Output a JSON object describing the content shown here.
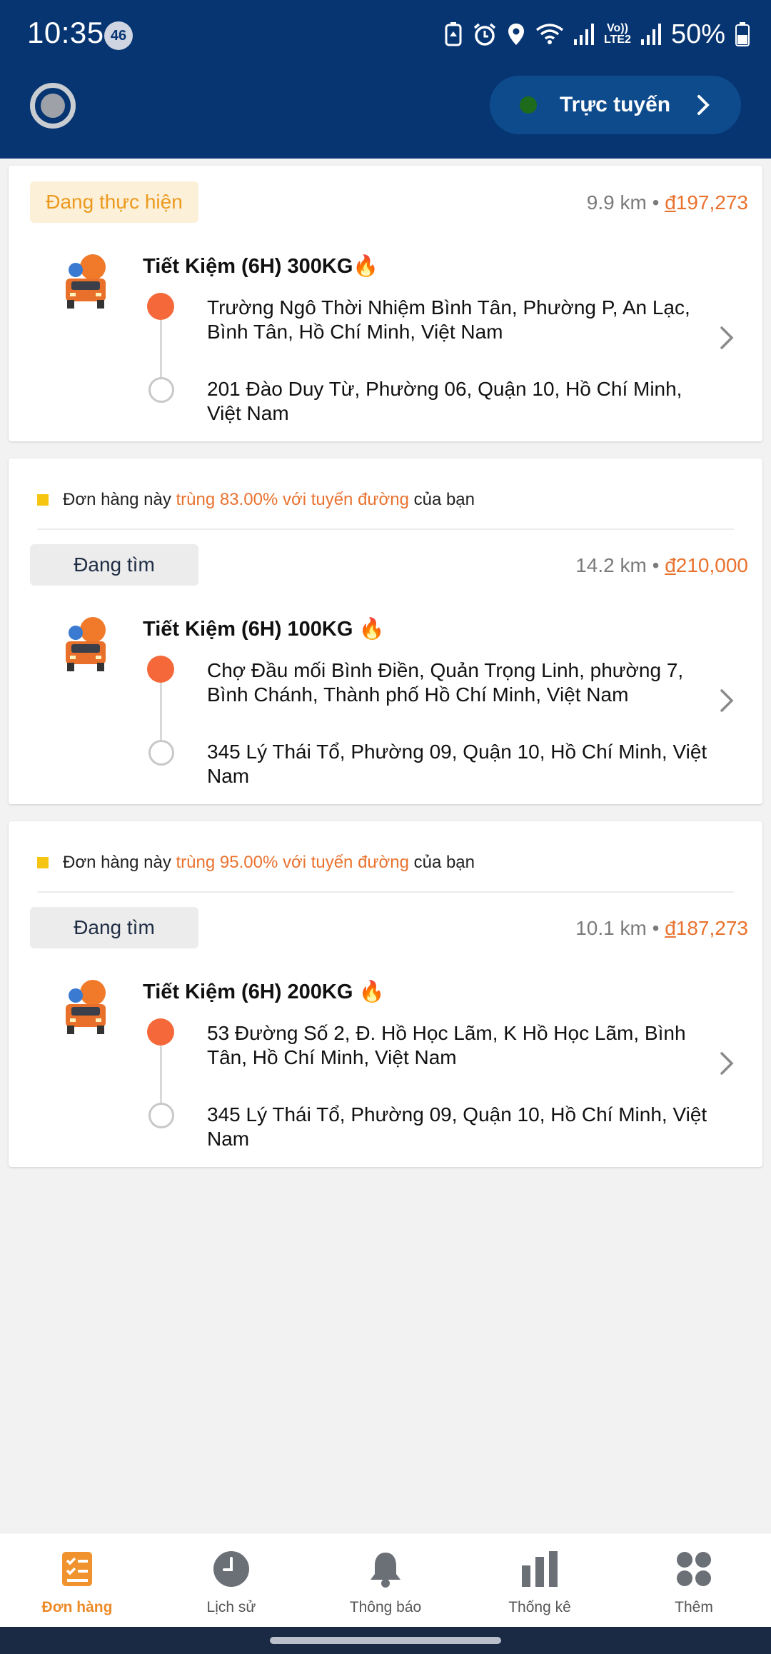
{
  "status_bar": {
    "time": "10:35",
    "notification_count": "46",
    "lte_line1": "Vo))",
    "lte_line2": "LTE2",
    "battery": "50%"
  },
  "header": {
    "online_label": "Trực tuyến"
  },
  "orders": [
    {
      "match_prefix": "",
      "match_highlight": "",
      "match_suffix": "",
      "status": "Đang thực hiện",
      "distance": "9.9 km",
      "currency": "đ",
      "price": "197,273",
      "service": "Tiết Kiệm (6H) 300KG🔥",
      "pickup": "Trường Ngô Thời Nhiệm Bình Tân, Phường P, An Lạc, Bình Tân, Hồ Chí Minh, Việt Nam",
      "dropoff": "201 Đào Duy Từ, Phường 06, Quận 10, Hồ Chí Minh, Việt Nam"
    },
    {
      "match_prefix": "Đơn hàng này ",
      "match_highlight": "trùng 83.00% với tuyến đường",
      "match_suffix": " của bạn",
      "status": "Đang tìm",
      "distance": "14.2 km",
      "currency": "đ",
      "price": "210,000",
      "service": "Tiết Kiệm (6H) 100KG 🔥",
      "pickup": "Chợ Đầu mối Bình Điền, Quản Trọng Linh, phường 7, Bình Chánh, Thành phố Hồ Chí Minh, Việt Nam",
      "dropoff": "345 Lý Thái Tổ, Phường 09, Quận 10, Hồ Chí Minh, Việt Nam"
    },
    {
      "match_prefix": "Đơn hàng này ",
      "match_highlight": "trùng 95.00% với tuyến đường",
      "match_suffix": " của bạn",
      "status": "Đang tìm",
      "distance": "10.1 km",
      "currency": "đ",
      "price": "187,273",
      "service": "Tiết Kiệm (6H) 200KG 🔥",
      "pickup": "53 Đường Số 2, Đ. Hồ Học Lãm, K Hồ Học Lãm, Bình Tân, Hồ Chí Minh, Việt Nam",
      "dropoff": "345 Lý Thái Tổ, Phường 09, Quận 10, Hồ Chí Minh, Việt Nam"
    }
  ],
  "nav": [
    {
      "label": "Đơn hàng",
      "icon": "orders-icon",
      "active": true
    },
    {
      "label": "Lịch sử",
      "icon": "history-icon"
    },
    {
      "label": "Thông báo",
      "icon": "bell-icon"
    },
    {
      "label": "Thống kê",
      "icon": "stats-icon"
    },
    {
      "label": "Thêm",
      "icon": "more-icon"
    }
  ],
  "colors": {
    "header": "#063572",
    "accent": "#e9722f",
    "active_nav": "#ec8a28"
  }
}
